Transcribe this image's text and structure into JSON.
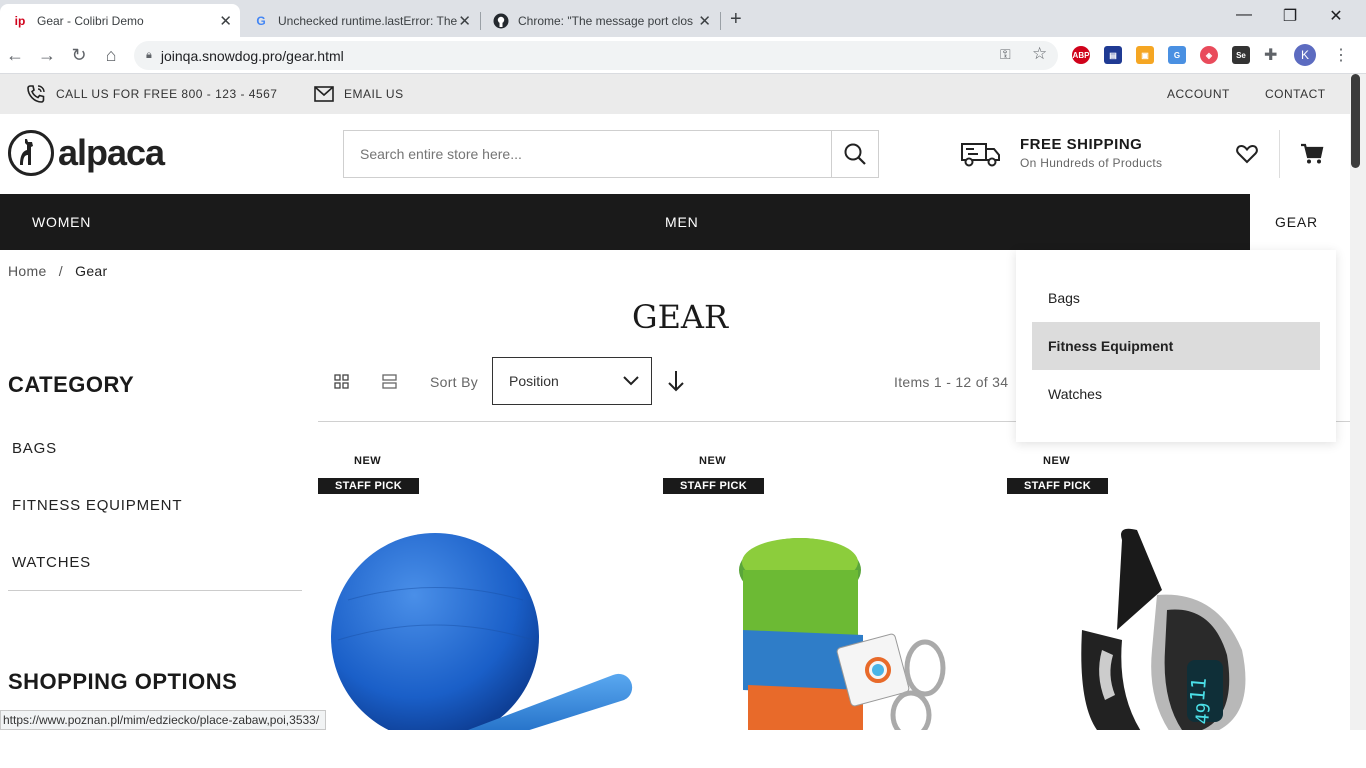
{
  "browser": {
    "tabs": [
      {
        "title": "Gear - Colibri Demo",
        "favicon": "ip"
      },
      {
        "title": "Unchecked runtime.lastError: The",
        "favicon": "G"
      },
      {
        "title": "Chrome: \"The message port clos",
        "favicon": "github"
      }
    ],
    "url": "joinqa.snowdog.pro/gear.html",
    "profile_initial": "K",
    "status_url": "https://www.poznan.pl/mim/edziecko/place-zabaw,poi,3533/"
  },
  "topbar": {
    "phone": "CALL US FOR FREE 800 - 123 - 4567",
    "email": "EMAIL US",
    "account": "ACCOUNT",
    "contact": "CONTACT"
  },
  "header": {
    "logo": "alpaca",
    "search_placeholder": "Search entire store here...",
    "shipping_title": "FREE SHIPPING",
    "shipping_sub": "On Hundreds of Products"
  },
  "nav": {
    "women": "WOMEN",
    "men": "MEN",
    "gear": "GEAR"
  },
  "dropdown": {
    "items": [
      "Bags",
      "Fitness Equipment",
      "Watches"
    ],
    "highlighted": "Fitness Equipment"
  },
  "breadcrumb": {
    "home": "Home",
    "sep": "/",
    "current": "Gear"
  },
  "page_title": "GEAR",
  "sidebar": {
    "category_heading": "CATEGORY",
    "categories": [
      "BAGS",
      "FITNESS EQUIPMENT",
      "WATCHES"
    ],
    "shopping_heading": "SHOPPING OPTIONS"
  },
  "toolbar": {
    "sort_label": "Sort By",
    "sort_value": "Position",
    "items_count": "Items 1 - 12 of 34"
  },
  "products": [
    {
      "badge_new": "NEW",
      "badge_staff": "STAFF PICK"
    },
    {
      "badge_new": "NEW",
      "badge_staff": "STAFF PICK"
    },
    {
      "badge_new": "NEW",
      "badge_staff": "STAFF PICK"
    }
  ],
  "colors": {
    "nav_bg": "#1a1a1a",
    "topbar_bg": "#ebebeb",
    "highlight_bg": "#dcdcdc"
  }
}
